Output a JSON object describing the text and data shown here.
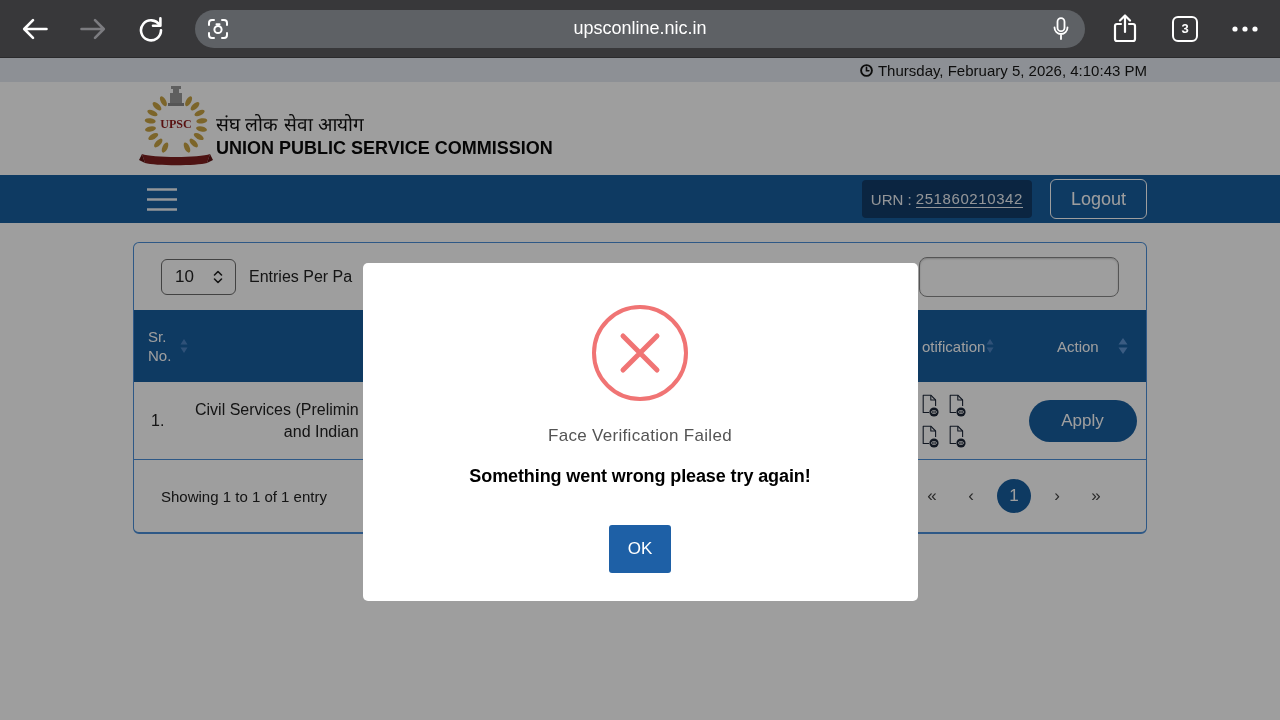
{
  "browser": {
    "nav_buttons": [
      {
        "kind": "back",
        "disabled": false
      },
      {
        "kind": "forward",
        "disabled": true
      },
      {
        "kind": "reload",
        "disabled": false
      }
    ],
    "url": "upsconline.nic.in",
    "tab_count": "3"
  },
  "date_strip": {
    "datetime": "Thursday, February 5, 2026, 4:10:43 PM"
  },
  "header": {
    "logo_text": "UPSC",
    "title_hindi": "संघ लोक सेवा आयोग",
    "title": "UNION PUBLIC SERVICE COMMISSION"
  },
  "nav_bar": {
    "urn_label": "URN :",
    "urn": "251860210342",
    "logout": "Logout"
  },
  "table_controls": {
    "entries_per_page": "10",
    "entries_label": "Entries Per Pa"
  },
  "table": {
    "columns": [
      {
        "label": "Sr. No.",
        "sortable": true
      },
      {
        "label": "otification",
        "sortable": true
      },
      {
        "label": "Action",
        "sortable": true
      }
    ],
    "rows": [
      {
        "sr": "1.",
        "name_lines": [
          "Civil Services (Prelimin",
          "and Indian"
        ],
        "action": "Apply"
      }
    ]
  },
  "footer": {
    "info": "Showing 1 to 1 of 1 entry",
    "pages": [
      {
        "label": "«",
        "selected": false
      },
      {
        "label": "‹",
        "selected": false
      },
      {
        "label": "1",
        "selected": true
      },
      {
        "label": "›",
        "selected": false
      },
      {
        "label": "»",
        "selected": false
      }
    ]
  },
  "dialog": {
    "kind": "error",
    "title": "Face Verification Failed",
    "message": "Something went wrong please try again!",
    "button": "OK"
  }
}
